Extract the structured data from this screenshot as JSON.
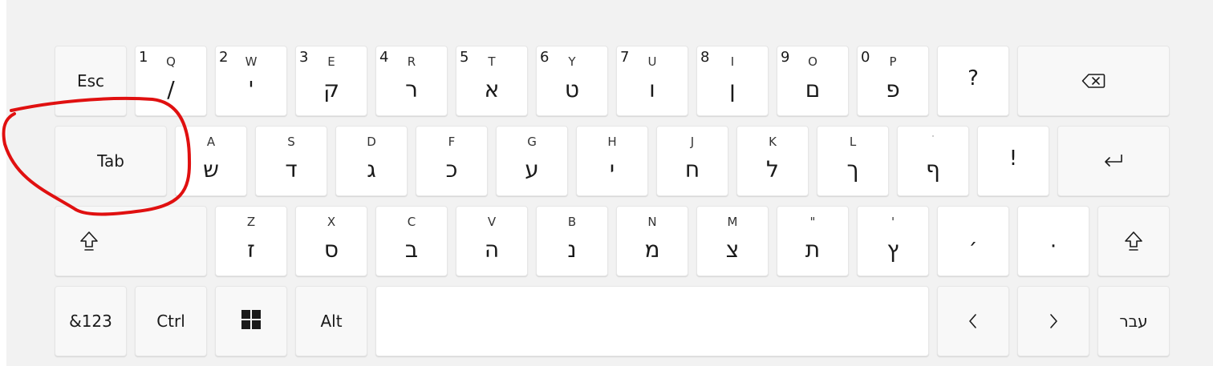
{
  "row1": [
    {
      "label": "Esc"
    },
    {
      "num": "1",
      "latin": "Q",
      "heb": "/"
    },
    {
      "num": "2",
      "latin": "W",
      "heb": "'"
    },
    {
      "num": "3",
      "latin": "E",
      "heb": "ק"
    },
    {
      "num": "4",
      "latin": "R",
      "heb": "ר"
    },
    {
      "num": "5",
      "latin": "T",
      "heb": "א"
    },
    {
      "num": "6",
      "latin": "Y",
      "heb": "ט"
    },
    {
      "num": "7",
      "latin": "U",
      "heb": "ו"
    },
    {
      "num": "8",
      "latin": "I",
      "heb": "ן"
    },
    {
      "num": "9",
      "latin": "O",
      "heb": "ם"
    },
    {
      "num": "0",
      "latin": "P",
      "heb": "פ"
    },
    {
      "label": "?"
    }
  ],
  "row2": [
    {
      "label": "Tab"
    },
    {
      "latin": "A",
      "heb": "ש"
    },
    {
      "latin": "S",
      "heb": "ד"
    },
    {
      "latin": "D",
      "heb": "ג"
    },
    {
      "latin": "F",
      "heb": "כ"
    },
    {
      "latin": "G",
      "heb": "ע"
    },
    {
      "latin": "H",
      "heb": "י"
    },
    {
      "latin": "J",
      "heb": "ח"
    },
    {
      "latin": "K",
      "heb": "ל"
    },
    {
      "latin": "L",
      "heb": "ך"
    },
    {
      "latin": "ׄ",
      "heb": "ף"
    },
    {
      "label": "!"
    }
  ],
  "row3": [
    {
      "latin": "Z",
      "heb": "ז"
    },
    {
      "latin": "X",
      "heb": "ס"
    },
    {
      "latin": "C",
      "heb": "ב"
    },
    {
      "latin": "V",
      "heb": "ה"
    },
    {
      "latin": "B",
      "heb": "נ"
    },
    {
      "latin": "N",
      "heb": "מ"
    },
    {
      "latin": "M",
      "heb": "צ"
    },
    {
      "latin": "\"",
      "heb": "ת"
    },
    {
      "latin": "'",
      "heb": "ץ"
    },
    {
      "label": "׳"
    },
    {
      "label": "·"
    }
  ],
  "row4": {
    "sym_label": "&123",
    "ctrl_label": "Ctrl",
    "alt_label": "Alt",
    "lang_label": "עבר"
  },
  "icons": {
    "backspace": "backspace-icon",
    "enter": "enter-icon",
    "shift": "shift-icon",
    "windows": "windows-icon",
    "left": "chevron-left-icon",
    "right": "chevron-right-icon"
  },
  "colors": {
    "key_bg": "#ffffff",
    "keyboard_bg": "#f2f2f2",
    "annotation": "#e01010"
  }
}
